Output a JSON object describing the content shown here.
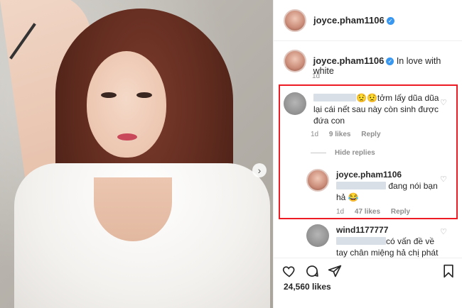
{
  "post": {
    "username": "joyce.pham1106",
    "caption": "In love with white",
    "caption_time": "1d",
    "likes": "24,560 likes"
  },
  "comments": [
    {
      "username_blurred": true,
      "text_line1": "😟😟tởm lấy dũa dũa",
      "text_line2": "lại cái nết sau này còn sinh được",
      "text_line3": "đứa con",
      "time": "1d",
      "likes": "9 likes",
      "reply_label": "Reply"
    }
  ],
  "hide_replies": "Hide replies",
  "reply": {
    "username": "joyce.pham1106",
    "text_after_blur": "đang nói bạn",
    "text_line2": "hả 😂",
    "time": "1d",
    "likes": "47 likes",
    "reply_label": "Reply"
  },
  "comment3": {
    "username": "wind1177777",
    "text_line1": "có vấn đề về",
    "text_line2": "tay chân miệng hả chị phát"
  },
  "icons": {
    "heart": "heart-icon",
    "comment": "comment-icon",
    "share": "share-icon",
    "bookmark": "bookmark-icon",
    "next": "chevron-right-icon"
  },
  "colors": {
    "verified": "#3897f0",
    "highlight_box": "#ed1c24",
    "meta_text": "#8e8e8e"
  }
}
